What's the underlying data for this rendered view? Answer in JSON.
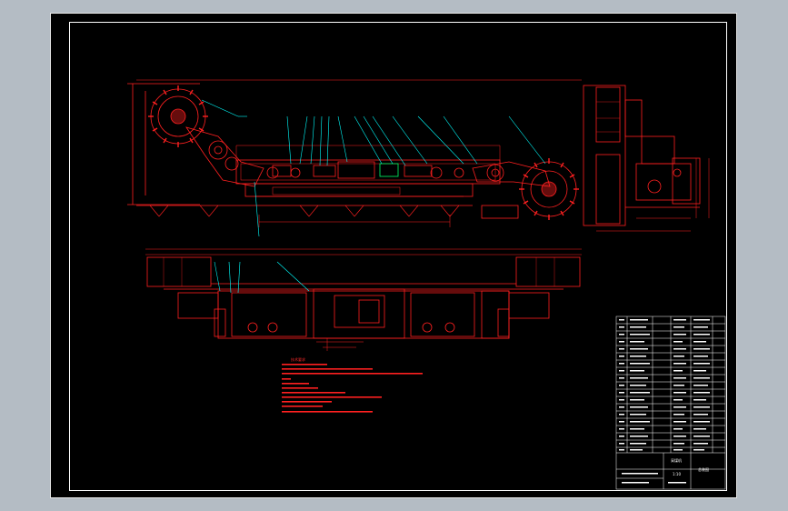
{
  "drawing": {
    "background": "#000000",
    "line_color": "#ff2020",
    "accent_color": "#00ffff",
    "highlight_color": "#00ff66",
    "border_color": "#ffffff",
    "notes_title": "技术要求",
    "title_block": {
      "name": "采煤机",
      "drawing_no": "总装图",
      "scale": "1:10"
    }
  }
}
